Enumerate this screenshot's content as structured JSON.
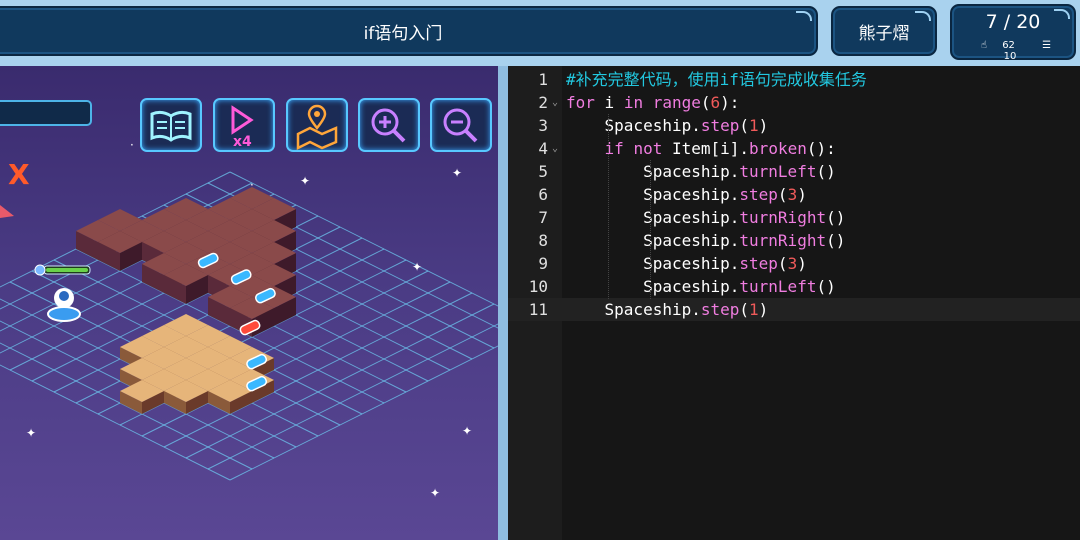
{
  "header": {
    "title": "if语句入门",
    "user": "熊子熠",
    "progress": "7 / 20",
    "likes": "62",
    "list_count": "10"
  },
  "toolbar": {
    "buttons": [
      "book-icon",
      "speed-x4-icon",
      "map-location-icon",
      "zoom-in-icon",
      "zoom-out-icon"
    ]
  },
  "game": {
    "marker": "X"
  },
  "editor": {
    "line_numbers": [
      "1",
      "2",
      "3",
      "4",
      "5",
      "6",
      "7",
      "8",
      "9",
      "10",
      "11"
    ],
    "lines": [
      [
        {
          "t": "#补充完整代码，使用if语句完成收集任务",
          "c": "cmt"
        }
      ],
      [
        {
          "t": "for",
          "c": "kw"
        },
        {
          "t": " i ",
          "c": ""
        },
        {
          "t": "in",
          "c": "kw"
        },
        {
          "t": " ",
          "c": ""
        },
        {
          "t": "range",
          "c": "fn"
        },
        {
          "t": "(",
          "c": ""
        },
        {
          "t": "6",
          "c": "num"
        },
        {
          "t": "):",
          "c": ""
        }
      ],
      [
        {
          "t": "    Spaceship.",
          "c": ""
        },
        {
          "t": "step",
          "c": "fn"
        },
        {
          "t": "(",
          "c": ""
        },
        {
          "t": "1",
          "c": "num"
        },
        {
          "t": ")",
          "c": ""
        }
      ],
      [
        {
          "t": "    ",
          "c": ""
        },
        {
          "t": "if",
          "c": "kw"
        },
        {
          "t": " ",
          "c": ""
        },
        {
          "t": "not",
          "c": "kw"
        },
        {
          "t": " Item[i].",
          "c": ""
        },
        {
          "t": "broken",
          "c": "fn"
        },
        {
          "t": "():",
          "c": ""
        }
      ],
      [
        {
          "t": "        Spaceship.",
          "c": ""
        },
        {
          "t": "turnLeft",
          "c": "fn"
        },
        {
          "t": "()",
          "c": ""
        }
      ],
      [
        {
          "t": "        Spaceship.",
          "c": ""
        },
        {
          "t": "step",
          "c": "fn"
        },
        {
          "t": "(",
          "c": ""
        },
        {
          "t": "3",
          "c": "num"
        },
        {
          "t": ")",
          "c": ""
        }
      ],
      [
        {
          "t": "        Spaceship.",
          "c": ""
        },
        {
          "t": "turnRight",
          "c": "fn"
        },
        {
          "t": "()",
          "c": ""
        }
      ],
      [
        {
          "t": "        Spaceship.",
          "c": ""
        },
        {
          "t": "turnRight",
          "c": "fn"
        },
        {
          "t": "()",
          "c": ""
        }
      ],
      [
        {
          "t": "        Spaceship.",
          "c": ""
        },
        {
          "t": "step",
          "c": "fn"
        },
        {
          "t": "(",
          "c": ""
        },
        {
          "t": "3",
          "c": "num"
        },
        {
          "t": ")",
          "c": ""
        }
      ],
      [
        {
          "t": "        Spaceship.",
          "c": ""
        },
        {
          "t": "turnLeft",
          "c": "fn"
        },
        {
          "t": "()",
          "c": ""
        }
      ],
      [
        {
          "t": "    Spaceship.",
          "c": ""
        },
        {
          "t": "step",
          "c": "fn"
        },
        {
          "t": "(",
          "c": ""
        },
        {
          "t": "1",
          "c": "num"
        },
        {
          "t": ")",
          "c": ""
        }
      ]
    ],
    "active_line": 11
  },
  "colors": {
    "keyword": "#f07de0",
    "number": "#f05a5a",
    "comment": "#22c8e0",
    "header_bg": "#10395d",
    "topbar": "#a9d2ee"
  }
}
